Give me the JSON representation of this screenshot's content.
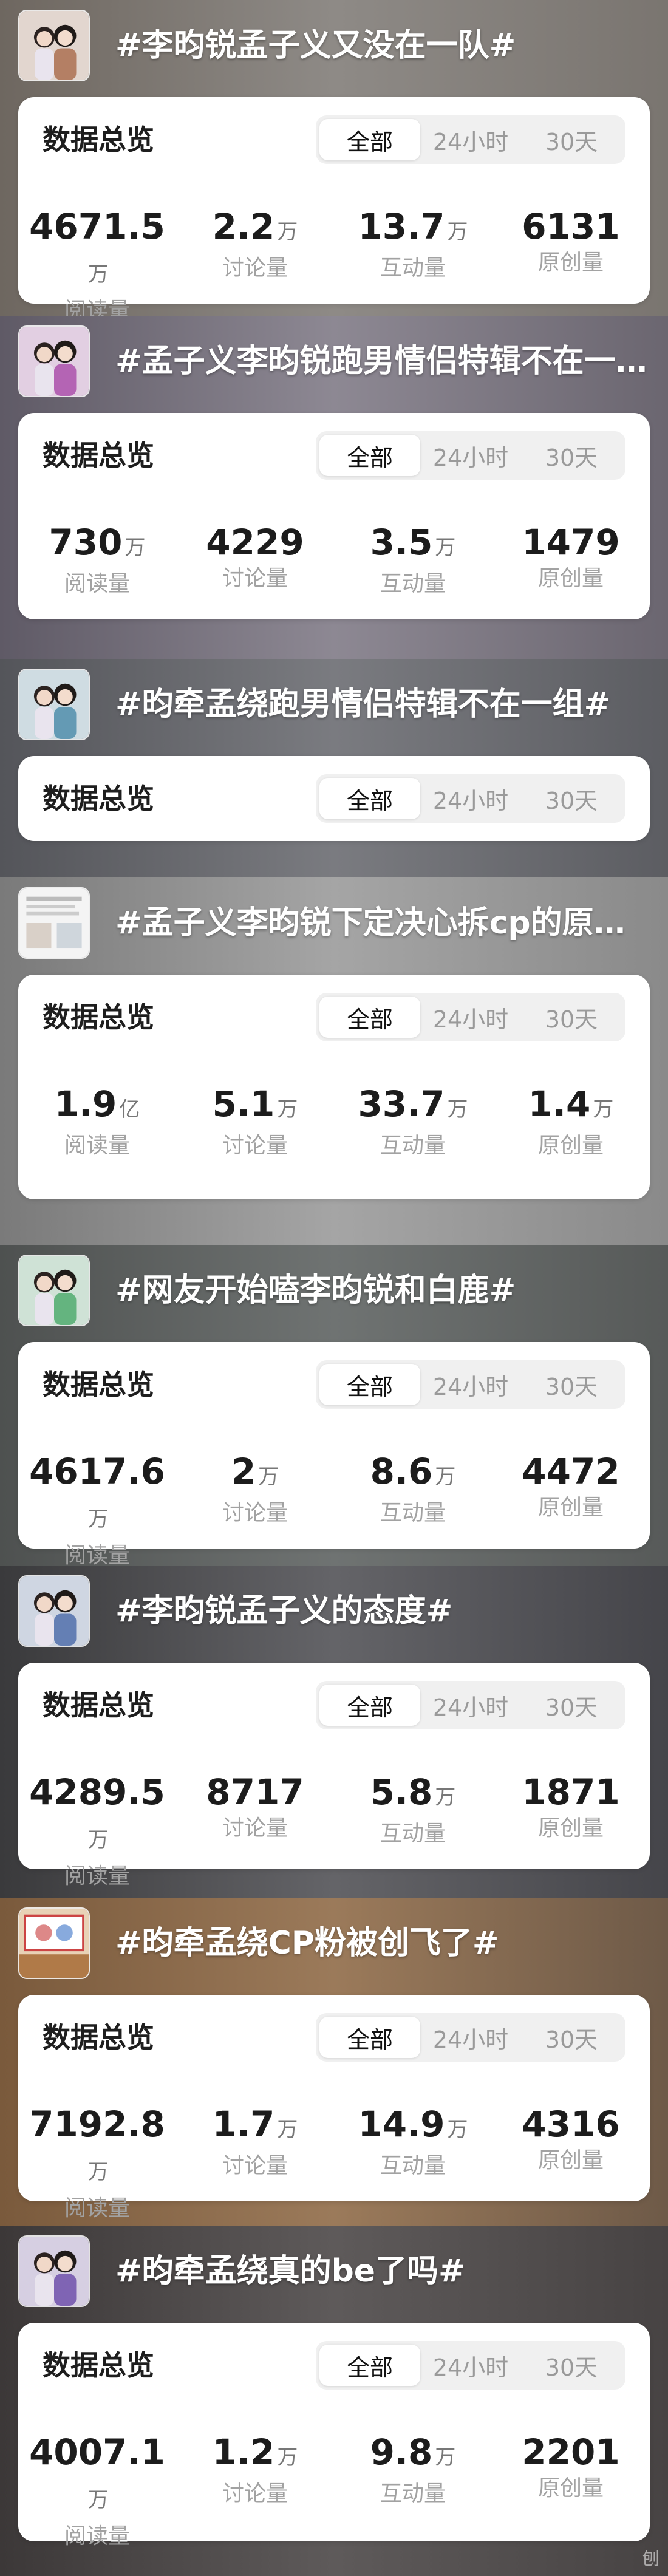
{
  "colors": {
    "card_bg": "#ffffff",
    "title_text": "#ffffff",
    "value_text": "#1c1c1c",
    "label_text": "#a2a2a2",
    "segment_bg": "#f0f0f0"
  },
  "overview_title": "数据总览",
  "tabs": [
    "全部",
    "24小时",
    "30天"
  ],
  "active_tab": "全部",
  "stat_labels": [
    "阅读量",
    "讨论量",
    "互动量",
    "原创量"
  ],
  "topics": [
    {
      "title": "#李昀锐孟子义又没在一队#",
      "thumb_icon": "couple-photo-icon",
      "stats": [
        {
          "value": "4671.5",
          "unit": "万"
        },
        {
          "value": "2.2",
          "unit": "万"
        },
        {
          "value": "13.7",
          "unit": "万"
        },
        {
          "value": "6131",
          "unit": ""
        }
      ]
    },
    {
      "title": "#孟子义李昀锐跑男情侣特辑不在一...",
      "thumb_icon": "couple-photo-icon",
      "stats": [
        {
          "value": "730",
          "unit": "万"
        },
        {
          "value": "4229",
          "unit": ""
        },
        {
          "value": "3.5",
          "unit": "万"
        },
        {
          "value": "1479",
          "unit": ""
        }
      ]
    },
    {
      "title": "#昀牵孟绕跑男情侣特辑不在一组#",
      "thumb_icon": "couple-photo-icon",
      "stats": []
    },
    {
      "title": "#孟子义李昀锐下定决心拆cp的原因#",
      "thumb_icon": "document-screenshot-icon",
      "stats": [
        {
          "value": "1.9",
          "unit": "亿"
        },
        {
          "value": "5.1",
          "unit": "万"
        },
        {
          "value": "33.7",
          "unit": "万"
        },
        {
          "value": "1.4",
          "unit": "万"
        }
      ]
    },
    {
      "title": "#网友开始嗑李昀锐和白鹿#",
      "thumb_icon": "couple-photo-icon",
      "stats": [
        {
          "value": "4617.6",
          "unit": "万"
        },
        {
          "value": "2",
          "unit": "万"
        },
        {
          "value": "8.6",
          "unit": "万"
        },
        {
          "value": "4472",
          "unit": ""
        }
      ]
    },
    {
      "title": "#李昀锐孟子义的态度#",
      "thumb_icon": "couple-photo-icon",
      "stats": [
        {
          "value": "4289.5",
          "unit": "万"
        },
        {
          "value": "8717",
          "unit": ""
        },
        {
          "value": "5.8",
          "unit": "万"
        },
        {
          "value": "1871",
          "unit": ""
        }
      ]
    },
    {
      "title": "#昀牵孟绕CP粉被创飞了#",
      "thumb_icon": "drawing-photo-icon",
      "stats": [
        {
          "value": "7192.8",
          "unit": "万"
        },
        {
          "value": "1.7",
          "unit": "万"
        },
        {
          "value": "14.9",
          "unit": "万"
        },
        {
          "value": "4316",
          "unit": ""
        }
      ]
    },
    {
      "title": "#昀牵孟绕真的be了吗#",
      "thumb_icon": "couple-photo-icon",
      "stats": [
        {
          "value": "4007.1",
          "unit": "万"
        },
        {
          "value": "1.2",
          "unit": "万"
        },
        {
          "value": "9.8",
          "unit": "万"
        },
        {
          "value": "2201",
          "unit": ""
        }
      ]
    }
  ],
  "corner_text": "刨"
}
